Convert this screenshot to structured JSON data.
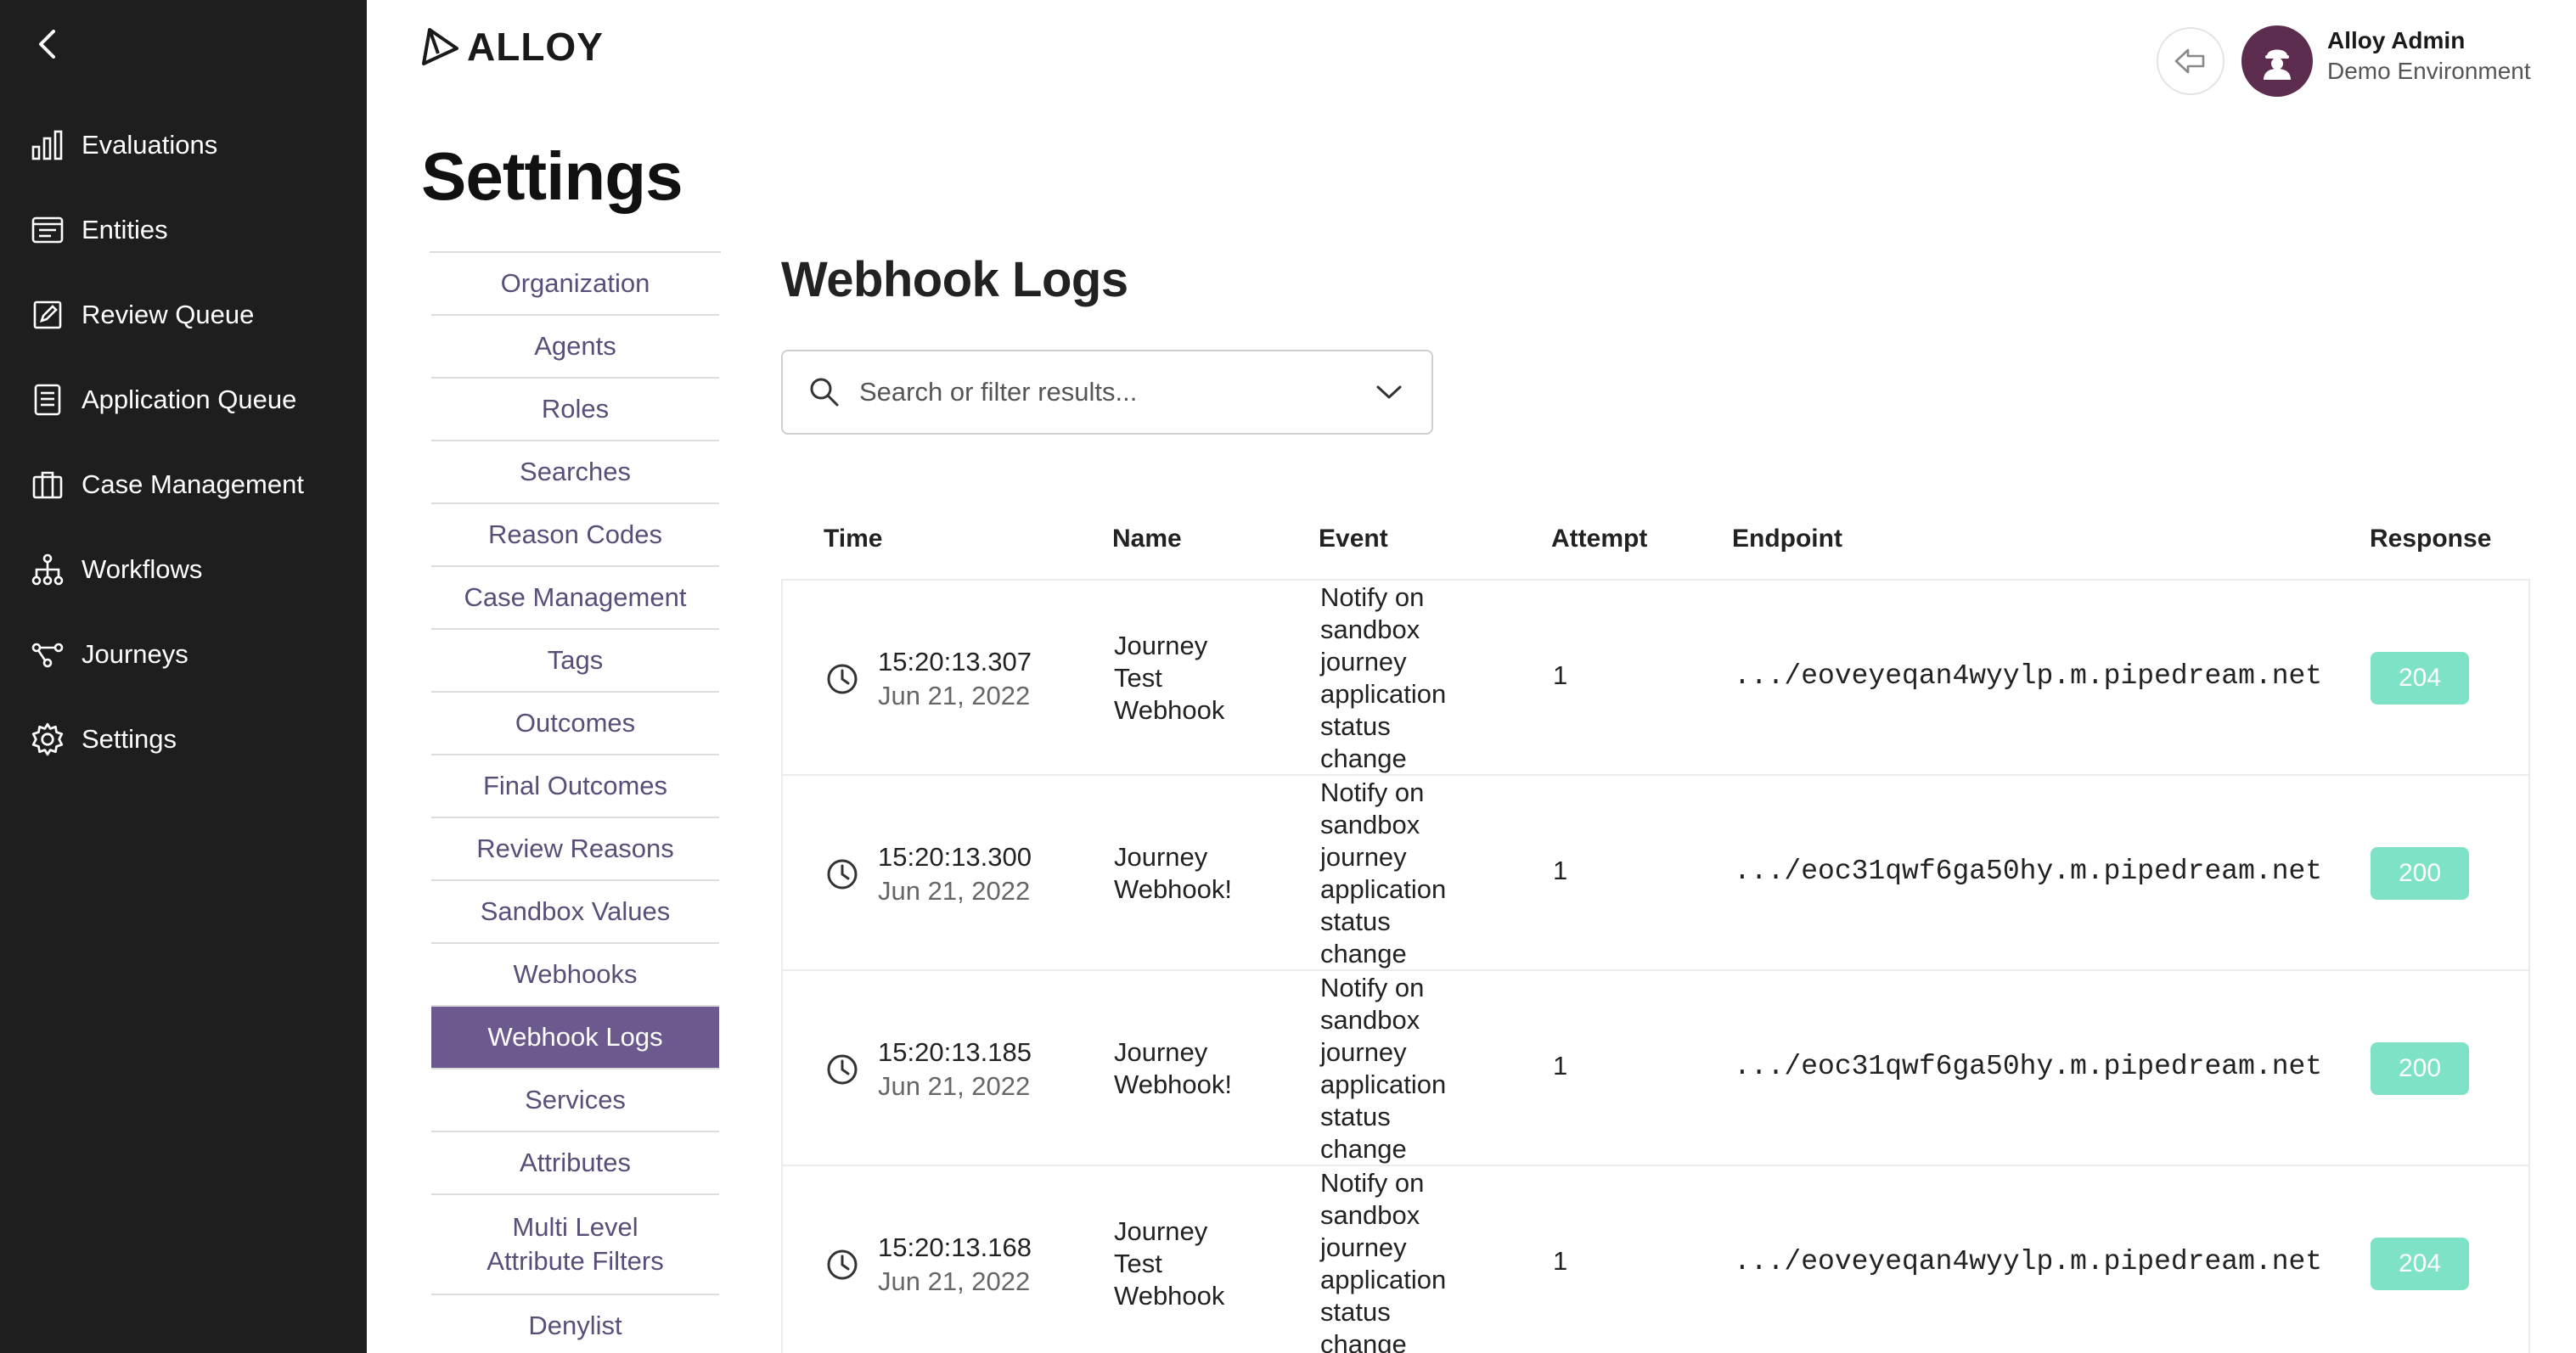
{
  "nav": {
    "items": [
      {
        "label": "Evaluations",
        "icon": "bar-chart-icon"
      },
      {
        "label": "Entities",
        "icon": "entities-icon"
      },
      {
        "label": "Review Queue",
        "icon": "edit-icon"
      },
      {
        "label": "Application Queue",
        "icon": "document-icon"
      },
      {
        "label": "Case Management",
        "icon": "briefcase-icon"
      },
      {
        "label": "Workflows",
        "icon": "workflow-icon"
      },
      {
        "label": "Journeys",
        "icon": "journey-icon"
      },
      {
        "label": "Settings",
        "icon": "gear-icon"
      }
    ]
  },
  "header": {
    "logo_text": "ALLOY",
    "user_name": "Alloy Admin",
    "user_environment": "Demo Environment"
  },
  "page": {
    "title": "Settings"
  },
  "settings_menu": {
    "items": [
      "Organization",
      "Agents",
      "Roles",
      "Searches",
      "Reason Codes",
      "Case Management",
      "Tags",
      "Outcomes",
      "Final Outcomes",
      "Review Reasons",
      "Sandbox Values",
      "Webhooks",
      "Webhook Logs",
      "Services",
      "Attributes",
      "Multi Level Attribute Filters",
      "Denylist"
    ],
    "active": "Webhook Logs"
  },
  "content": {
    "title": "Webhook Logs",
    "search_placeholder": "Search or filter results...",
    "columns": {
      "time": "Time",
      "name": "Name",
      "event": "Event",
      "attempt": "Attempt",
      "endpoint": "Endpoint",
      "response": "Response"
    },
    "rows": [
      {
        "time": "15:20:13.307",
        "date": "Jun 21, 2022",
        "name": "Journey Test Webhook",
        "event": "Notify on sandbox journey application status change",
        "attempt": "1",
        "endpoint": ".../eoveyeqan4wyylp.m.pipedream.net",
        "response": "204"
      },
      {
        "time": "15:20:13.300",
        "date": "Jun 21, 2022",
        "name": "Journey Webhook!",
        "event": "Notify on sandbox journey application status change",
        "attempt": "1",
        "endpoint": ".../eoc31qwf6ga50hy.m.pipedream.net",
        "response": "200"
      },
      {
        "time": "15:20:13.185",
        "date": "Jun 21, 2022",
        "name": "Journey Webhook!",
        "event": "Notify on sandbox journey application status change",
        "attempt": "1",
        "endpoint": ".../eoc31qwf6ga50hy.m.pipedream.net",
        "response": "200"
      },
      {
        "time": "15:20:13.168",
        "date": "Jun 21, 2022",
        "name": "Journey Test Webhook",
        "event": "Notify on sandbox journey application status change",
        "attempt": "1",
        "endpoint": ".../eoveyeqan4wyylp.m.pipedream.net",
        "response": "204"
      }
    ]
  },
  "colors": {
    "sidebar_bg": "#1e1e1e",
    "accent": "#6c5a8f",
    "menu_text": "#5a4e78",
    "response_badge": "#7ee3c6",
    "avatar_bg": "#5c2d4f"
  }
}
